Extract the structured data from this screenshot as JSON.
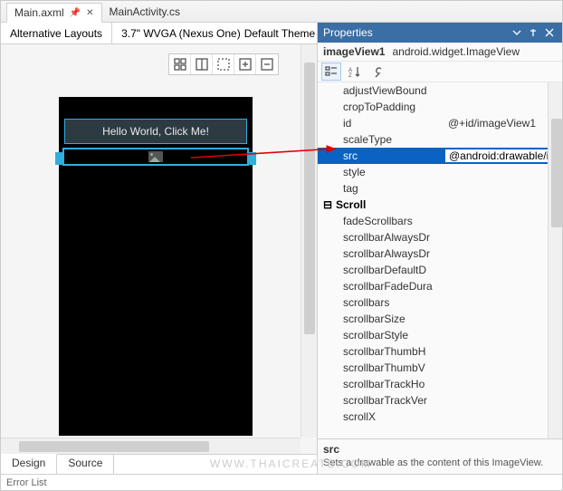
{
  "tabs": {
    "file1": "Main.axml",
    "file2": "MainActivity.cs"
  },
  "layoutbar": {
    "alt": "Alternative Layouts",
    "device": "3.7\" WVGA (Nexus One)",
    "theme": "Default Theme"
  },
  "device": {
    "button_text": "Hello World, Click Me!"
  },
  "designer_tabs": {
    "design": "Design",
    "source": "Source"
  },
  "error_list": {
    "title": "Error List"
  },
  "properties": {
    "panel_title": "Properties",
    "object_name": "imageView1",
    "object_type": "android.widget.ImageView",
    "rows": {
      "adjustViewBounds": "adjustViewBound",
      "cropToPadding": "cropToPadding",
      "id": "id",
      "id_val": "@+id/imageView1",
      "scaleType": "scaleType",
      "src": "src",
      "src_val": "@android:drawable/ic_",
      "style": "style",
      "tag": "tag",
      "scroll_cat": "Scroll",
      "fadeScrollbars": "fadeScrollbars",
      "scrollbarAlwaysDi": "scrollbarAlwaysDr",
      "scrollbarAlwaysDi2": "scrollbarAlwaysDr",
      "scrollbarDefaultD": "scrollbarDefaultD",
      "scrollbarFadeDura": "scrollbarFadeDura",
      "scrollbars": "scrollbars",
      "scrollbarSize": "scrollbarSize",
      "scrollbarStyle": "scrollbarStyle",
      "scrollbarThumbH": "scrollbarThumbH",
      "scrollbarThumbV": "scrollbarThumbV",
      "scrollbarTrackHo": "scrollbarTrackHo",
      "scrollbarTrackVer": "scrollbarTrackVer",
      "scrollX": "scrollX"
    },
    "footer": {
      "name": "src",
      "desc": "Sets a drawable as the content of this ImageView."
    }
  },
  "watermark": "WWW.THAICREATE.COM"
}
